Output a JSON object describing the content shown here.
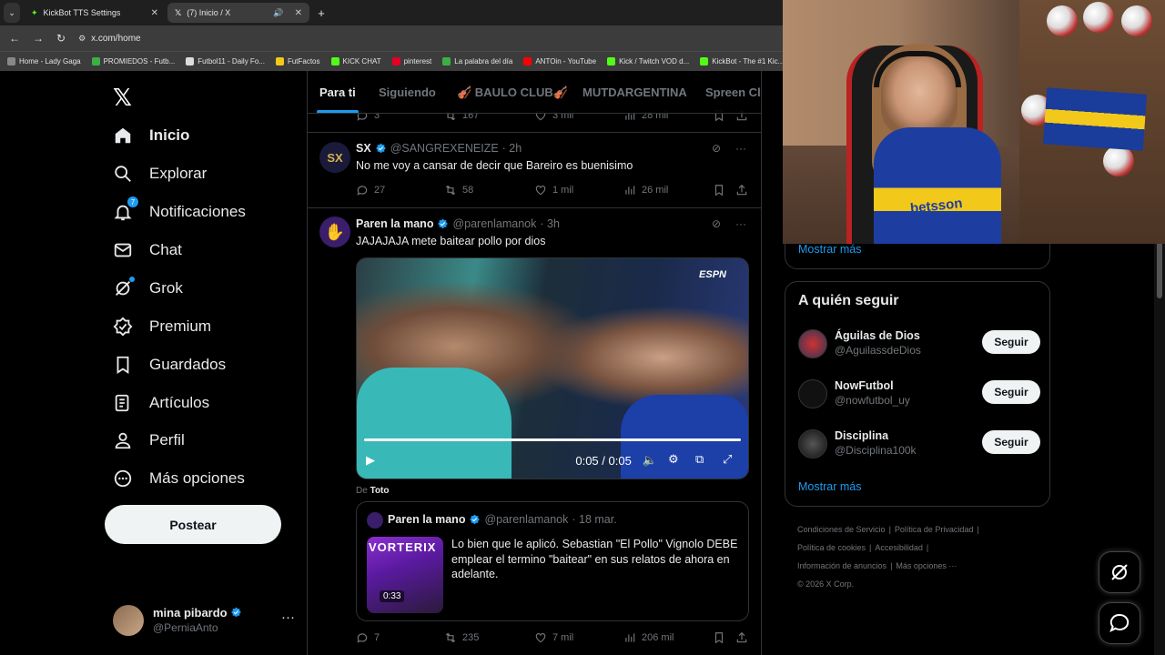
{
  "browser": {
    "tabs": [
      {
        "title": "KickBot TTS Settings",
        "active": false
      },
      {
        "title": "(7) Inicio / X",
        "active": true
      }
    ],
    "new_tab_symbol": "+",
    "url": "x.com/home",
    "bookmarks": [
      {
        "label": "Home - Lady Gaga",
        "color": "#888"
      },
      {
        "label": "PROMIEDOS - Futb...",
        "color": "#3cb043"
      },
      {
        "label": "Futbol11 - Daily Fo...",
        "color": "#ddd"
      },
      {
        "label": "FutFactos",
        "color": "#f2c81b"
      },
      {
        "label": "KICK CHAT",
        "color": "#53fc18"
      },
      {
        "label": "pinterest",
        "color": "#e60023"
      },
      {
        "label": "La palabra del día",
        "color": "#3cb043"
      },
      {
        "label": "ANTOin - YouTube",
        "color": "#ff0000"
      },
      {
        "label": "Kick / Twitch VOD d...",
        "color": "#53fc18"
      },
      {
        "label": "KickBot - The #1 Kic...",
        "color": "#53fc18"
      }
    ]
  },
  "nav": {
    "logo": "𝕏",
    "items": [
      {
        "label": "Inicio",
        "icon": "home-icon",
        "bold": true
      },
      {
        "label": "Explorar",
        "icon": "search-icon"
      },
      {
        "label": "Notificaciones",
        "icon": "bell-icon",
        "badge": "7"
      },
      {
        "label": "Chat",
        "icon": "mail-icon"
      },
      {
        "label": "Grok",
        "icon": "grok-icon",
        "dot": true
      },
      {
        "label": "Premium",
        "icon": "premium-icon"
      },
      {
        "label": "Guardados",
        "icon": "bookmark-icon"
      },
      {
        "label": "Artículos",
        "icon": "articles-icon"
      },
      {
        "label": "Perfil",
        "icon": "person-icon"
      },
      {
        "label": "Más opciones",
        "icon": "more-circle-icon"
      }
    ],
    "post_button": "Postear",
    "profile": {
      "name": "mina pibardo",
      "handle": "@PerniaAnto",
      "more": "···"
    }
  },
  "timeline": {
    "tabs": [
      "Para ti",
      "Siguiendo",
      "🎻 BAULO CLUB🎻",
      "MUTDARGENTINA",
      "Spreen Cla"
    ],
    "prev_tweet_actions": {
      "replies": "3",
      "reposts": "167",
      "likes": "3 mil",
      "views": "28 mil"
    },
    "tweets": [
      {
        "name": "SX",
        "handle": "@SANGREXENEIZE",
        "time": "· 2h",
        "text": "No me voy a cansar de decir que Bareiro es buenisimo",
        "replies": "27",
        "reposts": "58",
        "likes": "1 mil",
        "views": "26 mil"
      },
      {
        "name": "Paren la mano",
        "handle": "@parenlamanok",
        "time": "· 3h",
        "text": "JAJAJAJA mete baitear pollo por dios",
        "video": {
          "time": "0:05 / 0:05",
          "watermark": "ESPN"
        },
        "from_label": "De",
        "from_name": "Toto",
        "quote": {
          "name": "Paren la mano",
          "handle": "@parenlamanok",
          "time": "· 18 mar.",
          "text": "Lo bien que le aplicó. Sebastian \"El Pollo\" Vignolo DEBE emplear el termino \"baitear\" en sus relatos de ahora en adelante.",
          "thumb_label": "VORTERIX",
          "duration": "0:33"
        },
        "replies": "7",
        "reposts": "235",
        "likes": "7 mil",
        "views": "206 mil"
      }
    ]
  },
  "sidebar": {
    "top_show_more": "Mostrar más",
    "who_to_follow": {
      "title": "A quién seguir",
      "users": [
        {
          "name": "Águilas de Dios",
          "handle": "@AguilassdeDios",
          "button": "Seguir"
        },
        {
          "name": "NowFutbol",
          "handle": "@nowfutbol_uy",
          "button": "Seguir"
        },
        {
          "name": "Disciplina",
          "handle": "@Disciplina100k",
          "button": "Seguir"
        }
      ],
      "show_more": "Mostrar más"
    },
    "footer_links": [
      "Condiciones de Servicio",
      "|",
      "Política de Privacidad",
      "|",
      "Política de cookies",
      "|",
      "Accesibilidad",
      "|",
      "Información de anuncios",
      "|",
      "Más opciones ···",
      "© 2026 X Corp."
    ],
    "webcam_sponsor": "betsson"
  },
  "colors": {
    "accent": "#1d9bf0",
    "bg": "#000000",
    "muted": "#71767b"
  }
}
